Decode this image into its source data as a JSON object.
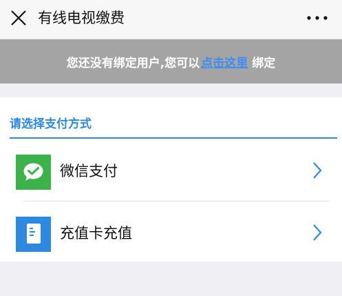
{
  "header": {
    "title": "有线电视缴费",
    "close_icon": "close-icon",
    "more_icon": "more-dots-icon"
  },
  "banner": {
    "text_before": "您还没有绑定用户,您可以",
    "link_text": "点击这里",
    "text_after": "绑定"
  },
  "payment": {
    "section_title": "请选择支付方式",
    "options": [
      {
        "label": "微信支付",
        "icon": "wechat-pay-icon",
        "color": "#3bb24a"
      },
      {
        "label": "充值卡充值",
        "icon": "recharge-card-icon",
        "color": "#2d88e0"
      }
    ]
  },
  "colors": {
    "accent": "#2d88e0",
    "link": "#3d8cf7",
    "banner_bg": "#a4a4a4"
  }
}
